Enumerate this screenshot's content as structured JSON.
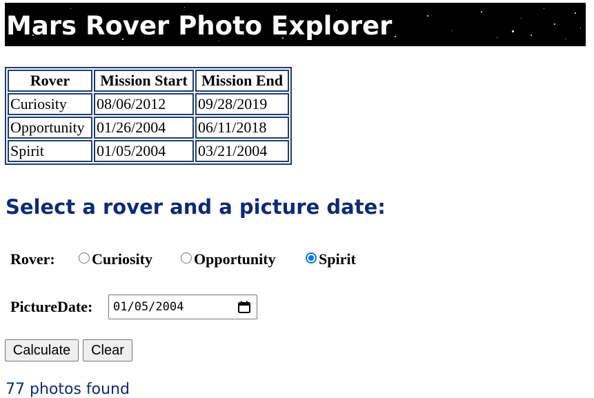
{
  "header": {
    "title": "Mars Rover Photo Explorer"
  },
  "mission_table": {
    "headers": [
      "Rover",
      "Mission Start",
      "Mission End"
    ],
    "rows": [
      [
        "Curiosity",
        "08/06/2012",
        "09/28/2019"
      ],
      [
        "Opportunity",
        "01/26/2004",
        "06/11/2018"
      ],
      [
        "Spirit",
        "01/05/2004",
        "03/21/2004"
      ]
    ]
  },
  "form": {
    "heading": "Select a rover and a picture date:",
    "rover_label": "Rover:",
    "rover_options": [
      {
        "label": "Curiosity",
        "checked": false
      },
      {
        "label": "Opportunity",
        "checked": false
      },
      {
        "label": "Spirit",
        "checked": true
      }
    ],
    "date_label": "PictureDate:",
    "date_value": "01/05/2004",
    "calculate_label": "Calculate",
    "clear_label": "Clear"
  },
  "result": {
    "text": "77 photos found"
  },
  "colors": {
    "heading": "#0e2a75",
    "table_border": "#1f3a70",
    "radio_checked": "#0075ff",
    "banner_bg": "#000000"
  },
  "icons": {
    "date_picker": "calendar-icon"
  }
}
